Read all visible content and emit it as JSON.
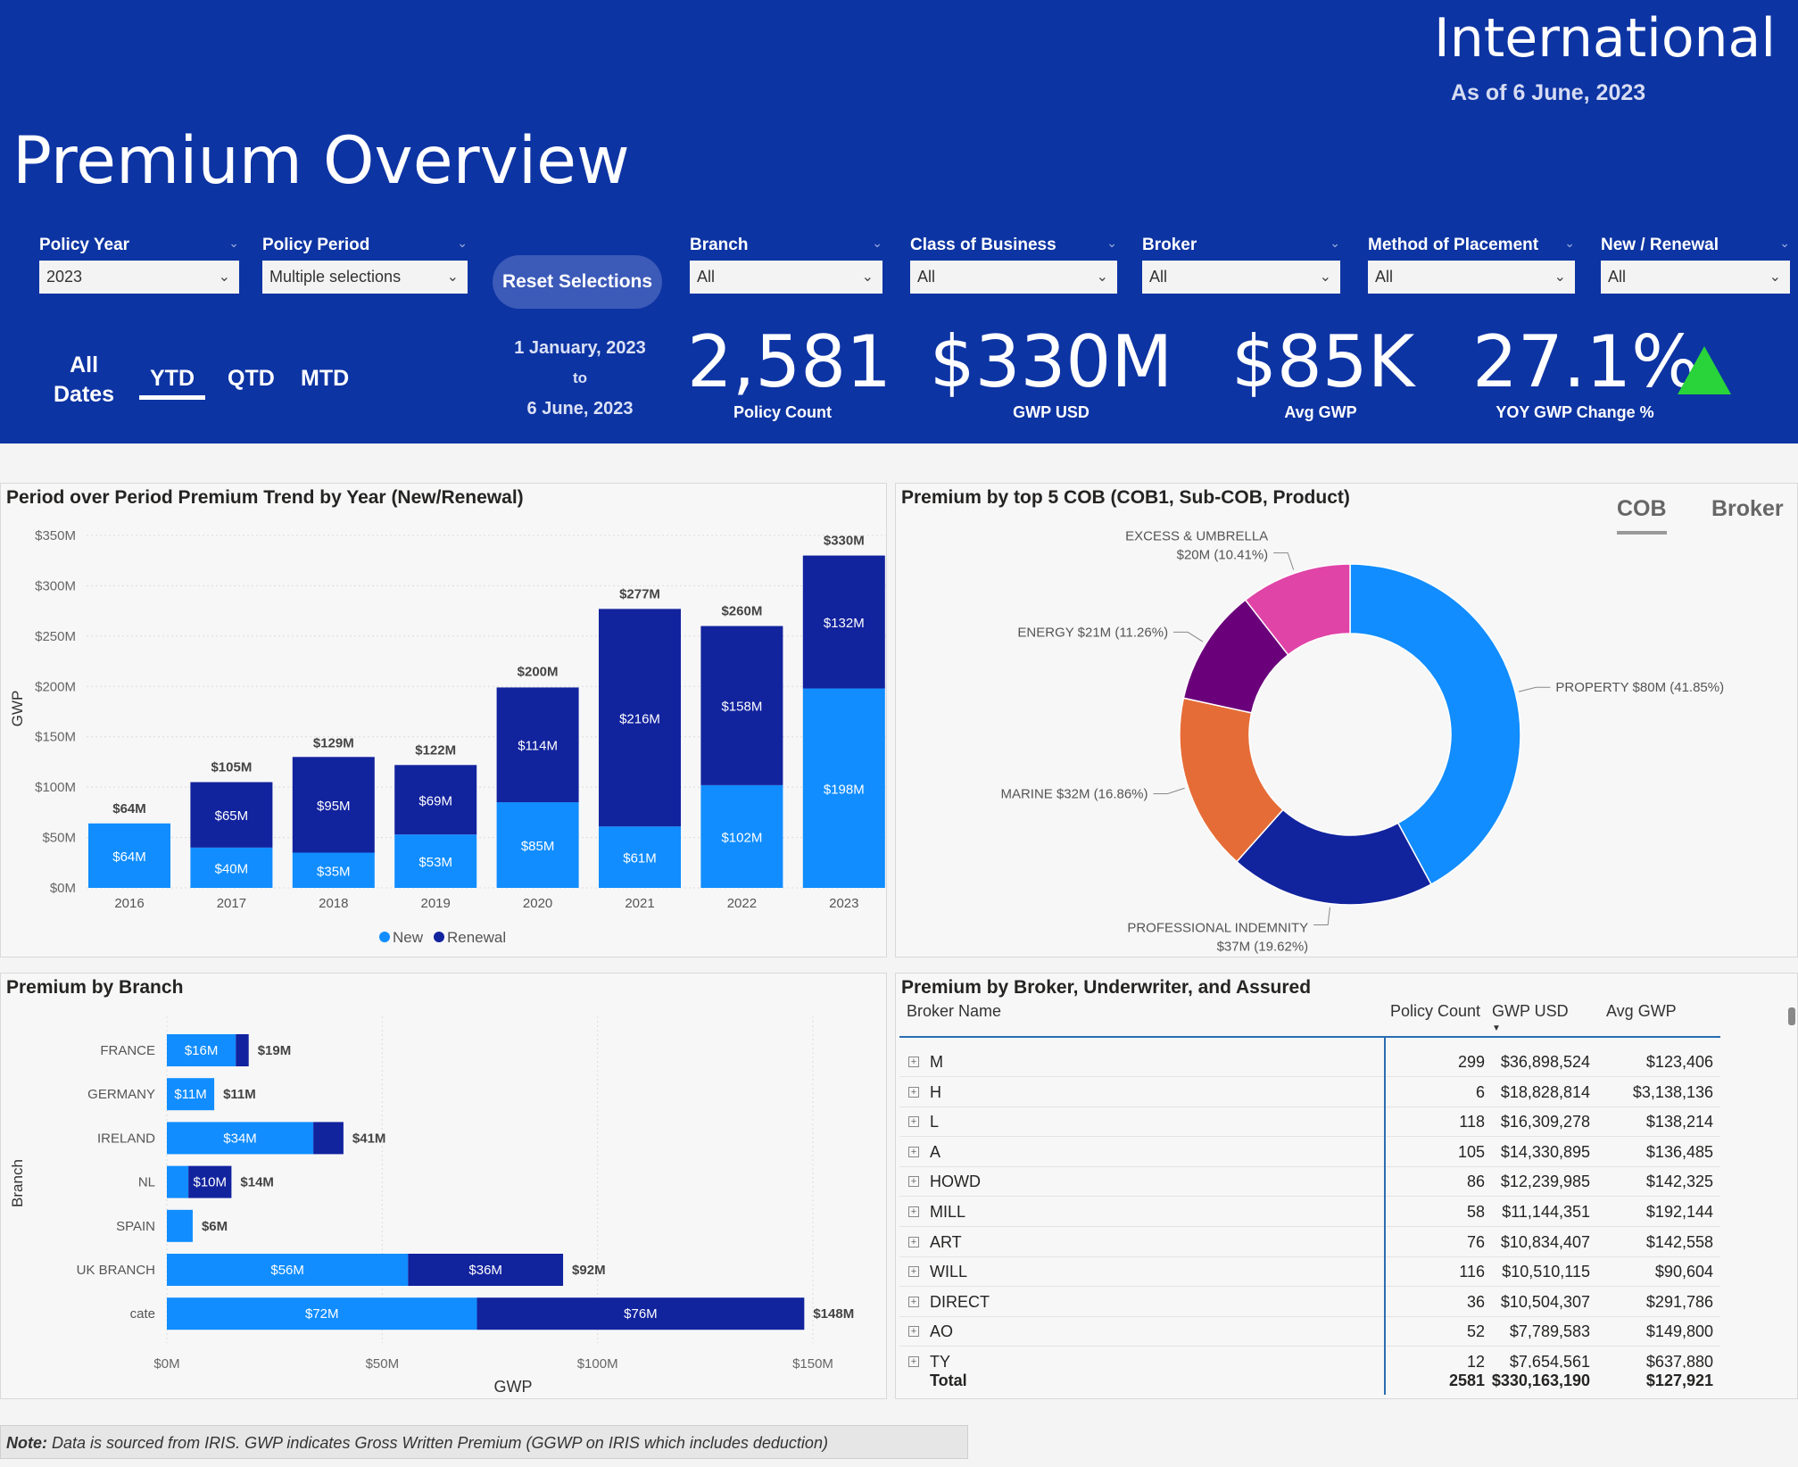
{
  "header": {
    "region": "International",
    "as_of": "As of 6 June, 2023",
    "title": "Premium Overview",
    "reset_label": "Reset Selections"
  },
  "filters": [
    {
      "label": "Policy Year",
      "value": "2023"
    },
    {
      "label": "Policy Period",
      "value": "Multiple selections"
    },
    {
      "label": "Branch",
      "value": "All"
    },
    {
      "label": "Class of Business",
      "value": "All"
    },
    {
      "label": "Broker",
      "value": "All"
    },
    {
      "label": "Method of Placement",
      "value": "All"
    },
    {
      "label": "New / Renewal",
      "value": "All"
    }
  ],
  "period_tabs": {
    "all_line1": "All",
    "all_line2": "Dates",
    "ytd": "YTD",
    "qtd": "QTD",
    "mtd": "MTD",
    "active": "YTD"
  },
  "date_range": {
    "start": "1 January, 2023",
    "to": "to",
    "end": "6 June, 2023"
  },
  "kpis": [
    {
      "value": "2,581",
      "caption": "Policy Count"
    },
    {
      "value": "$330M",
      "caption": "GWP USD"
    },
    {
      "value": "$85K",
      "caption": "Avg GWP"
    },
    {
      "value": "27.1%",
      "caption": "YOY GWP Change %"
    }
  ],
  "colors": {
    "header": "#0d34a3",
    "new": "#118dff",
    "renewal": "#12239e",
    "up": "#29d43a"
  },
  "panels": {
    "trend_title": "Period over Period Premium Trend by Year (New/Renewal)",
    "cob_title": "Premium by top 5 COB (COB1, Sub-COB, Product)",
    "branch_title": "Premium by Branch",
    "broker_title": "Premium by Broker, Underwriter, and Assured",
    "cob_tab": "COB",
    "broker_tab": "Broker"
  },
  "chart_data": [
    {
      "type": "bar",
      "stacked": true,
      "title": "Period over Period Premium Trend by Year (New/Renewal)",
      "ylabel": "GWP",
      "categories": [
        "2016",
        "2017",
        "2018",
        "2019",
        "2020",
        "2021",
        "2022",
        "2023"
      ],
      "series": [
        {
          "name": "New",
          "values": [
            64,
            40,
            35,
            53,
            85,
            61,
            102,
            198
          ],
          "labels": [
            "$64M",
            "$40M",
            "$35M",
            "$53M",
            "$85M",
            "$61M",
            "$102M",
            "$198M"
          ]
        },
        {
          "name": "Renewal",
          "values": [
            0,
            65,
            95,
            69,
            114,
            216,
            158,
            132
          ],
          "labels": [
            "",
            "$65M",
            "$95M",
            "$69M",
            "$114M",
            "$216M",
            "$158M",
            "$132M"
          ]
        }
      ],
      "totals": [
        "$64M",
        "$105M",
        "$129M",
        "$122M",
        "$200M",
        "$277M",
        "$260M",
        "$330M"
      ],
      "total_values": [
        64,
        105,
        129,
        122,
        200,
        277,
        260,
        330
      ],
      "yticks": [
        "$0M",
        "$50M",
        "$100M",
        "$150M",
        "$200M",
        "$250M",
        "$300M",
        "$350M"
      ],
      "ylim": [
        0,
        350
      ],
      "legend": "bottom"
    },
    {
      "type": "pie",
      "donut": true,
      "title": "Premium by top 5 COB (COB1, Sub-COB, Product)",
      "slices": [
        {
          "name": "PROPERTY",
          "value": 80,
          "pct": 41.85,
          "label": "PROPERTY $80M (41.85%)",
          "color": "#118dff"
        },
        {
          "name": "PROFESSIONAL INDEMNITY",
          "value": 37,
          "pct": 19.62,
          "label": "PROFESSIONAL INDEMNITY",
          "label2": "$37M (19.62%)",
          "color": "#12239e"
        },
        {
          "name": "MARINE",
          "value": 32,
          "pct": 16.86,
          "label": "MARINE $32M (16.86%)",
          "color": "#e66c37"
        },
        {
          "name": "ENERGY",
          "value": 21,
          "pct": 11.26,
          "label": "ENERGY $21M (11.26%)",
          "color": "#6b007b"
        },
        {
          "name": "EXCESS & UMBRELLA",
          "value": 20,
          "pct": 10.41,
          "label": "EXCESS & UMBRELLA",
          "label2": "$20M (10.41%)",
          "color": "#e044a7"
        }
      ]
    },
    {
      "type": "bar",
      "orientation": "horizontal",
      "stacked": true,
      "title": "Premium by Branch",
      "xlabel": "GWP",
      "ylabel": "Branch",
      "categories": [
        "FRANCE",
        "GERMANY",
        "IRELAND",
        "NL",
        "SPAIN",
        "UK BRANCH",
        "cate"
      ],
      "series": [
        {
          "name": "New",
          "values": [
            16,
            11,
            34,
            5,
            6,
            56,
            72
          ],
          "labels": [
            "$16M",
            "$11M",
            "$34M",
            "",
            "",
            "$56M",
            "$72M"
          ]
        },
        {
          "name": "Renewal",
          "values": [
            3,
            0,
            7,
            10,
            0,
            36,
            76
          ],
          "labels": [
            "",
            "",
            "",
            "$10M",
            "",
            "$36M",
            "$76M"
          ]
        }
      ],
      "totals": [
        "$19M",
        "$11M",
        "$41M",
        "$14M",
        "$6M",
        "$92M",
        "$148M"
      ],
      "total_values": [
        19,
        11,
        41,
        14,
        6,
        92,
        148
      ],
      "xticks": [
        "$0M",
        "$50M",
        "$100M",
        "$150M"
      ],
      "xlim": [
        0,
        150
      ]
    }
  ],
  "broker_table": {
    "headers": {
      "name": "Broker Name",
      "count": "Policy Count",
      "gwp": "GWP USD",
      "avg": "Avg GWP"
    },
    "rows": [
      {
        "name": "M",
        "count": "299",
        "gwp": "$36,898,524",
        "avg": "$123,406"
      },
      {
        "name": "H",
        "count": "6",
        "gwp": "$18,828,814",
        "avg": "$3,138,136"
      },
      {
        "name": "L",
        "count": "118",
        "gwp": "$16,309,278",
        "avg": "$138,214"
      },
      {
        "name": "A",
        "count": "105",
        "gwp": "$14,330,895",
        "avg": "$136,485"
      },
      {
        "name": "HOWD",
        "count": "86",
        "gwp": "$12,239,985",
        "avg": "$142,325"
      },
      {
        "name": "MILL",
        "count": "58",
        "gwp": "$11,144,351",
        "avg": "$192,144"
      },
      {
        "name": "ART",
        "count": "76",
        "gwp": "$10,834,407",
        "avg": "$142,558"
      },
      {
        "name": "WILL",
        "count": "116",
        "gwp": "$10,510,115",
        "avg": "$90,604"
      },
      {
        "name": "DIRECT",
        "count": "36",
        "gwp": "$10,504,307",
        "avg": "$291,786"
      },
      {
        "name": "AO",
        "count": "52",
        "gwp": "$7,789,583",
        "avg": "$149,800"
      },
      {
        "name": "TY",
        "count": "12",
        "gwp": "$7,654,561",
        "avg": "$637,880"
      }
    ],
    "total": {
      "name": "Total",
      "count": "2581",
      "gwp": "$330,163,190",
      "avg": "$127,921"
    }
  },
  "note": {
    "bold": "Note:",
    "text": " Data is sourced from IRIS. GWP indicates Gross Written Premium (GGWP on IRIS which includes deduction)"
  }
}
